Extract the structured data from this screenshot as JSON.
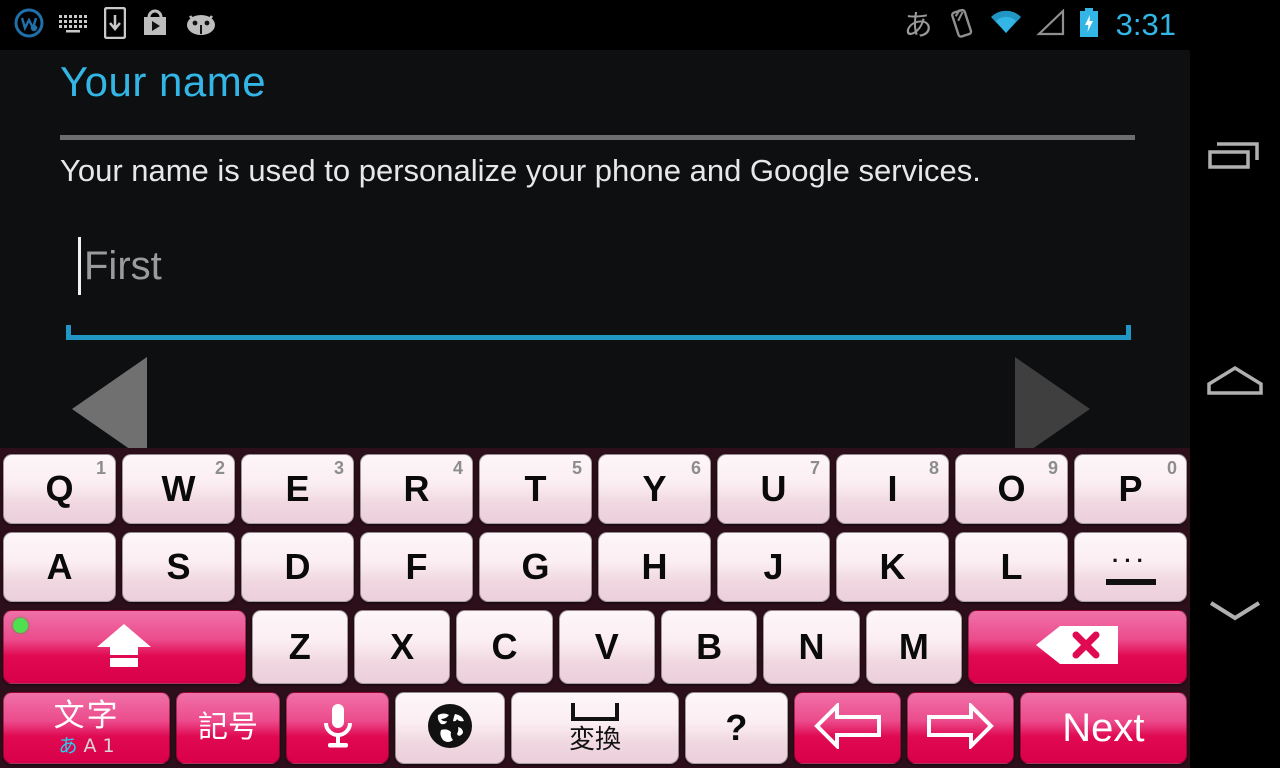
{
  "statusbar": {
    "left_icons": [
      {
        "name": "whatsapp-like-app-icon",
        "label": "w"
      },
      {
        "name": "keyboard-icon",
        "label": "keyboard"
      },
      {
        "name": "download-to-device-icon",
        "label": "download"
      },
      {
        "name": "play-store-icon",
        "label": "play-store"
      },
      {
        "name": "android-mascot-icon",
        "label": "android"
      }
    ],
    "ime_indicator": "あ",
    "right_icons": [
      {
        "name": "vibrate-icon",
        "label": "vibrate"
      },
      {
        "name": "wifi-icon",
        "label": "wifi"
      },
      {
        "name": "signal-icon",
        "label": "signal"
      },
      {
        "name": "battery-charging-icon",
        "label": "battery"
      }
    ],
    "clock": "3:31",
    "clock_color": "#33b5e5"
  },
  "content": {
    "title": "Your name",
    "title_color": "#33b5e5",
    "description": "Your name is used to personalize your phone and Google services.",
    "name_field": {
      "value": "",
      "placeholder": "First",
      "underline_color": "#2196c4"
    },
    "prev_arrow_label": "Previous",
    "next_arrow_label": "Next"
  },
  "navbar": {
    "recent_label": "Recent apps",
    "home_label": "Home",
    "hide_keyboard_label": "Hide keyboard"
  },
  "keyboard": {
    "background_color": "#2c0f1a",
    "key_pink_color": "#e00a52",
    "row1": [
      {
        "label": "Q",
        "sup": "1"
      },
      {
        "label": "W",
        "sup": "2"
      },
      {
        "label": "E",
        "sup": "3"
      },
      {
        "label": "R",
        "sup": "4"
      },
      {
        "label": "T",
        "sup": "5"
      },
      {
        "label": "Y",
        "sup": "6"
      },
      {
        "label": "U",
        "sup": "7"
      },
      {
        "label": "I",
        "sup": "8"
      },
      {
        "label": "O",
        "sup": "9"
      },
      {
        "label": "P",
        "sup": "0"
      }
    ],
    "row2": [
      {
        "label": "A"
      },
      {
        "label": "S"
      },
      {
        "label": "D"
      },
      {
        "label": "F"
      },
      {
        "label": "G"
      },
      {
        "label": "H"
      },
      {
        "label": "J"
      },
      {
        "label": "K"
      },
      {
        "label": "L"
      },
      {
        "label": "…—",
        "name": "ellipsis-dash-key"
      }
    ],
    "row3": {
      "shift_label": "shift",
      "letters": [
        {
          "label": "Z"
        },
        {
          "label": "X"
        },
        {
          "label": "C"
        },
        {
          "label": "V"
        },
        {
          "label": "B"
        },
        {
          "label": "N"
        },
        {
          "label": "M"
        }
      ],
      "backspace_label": "backspace"
    },
    "row4": {
      "mode_main": "文字",
      "mode_sub_a": "あ",
      "mode_sub_b": "A",
      "mode_sub_c": "1",
      "symbol_label": "記号",
      "mic_label": "voice input",
      "globe_label": "language switch",
      "space_label": "変換",
      "question_label": "?",
      "arrow_left_label": "move cursor left",
      "arrow_right_label": "move cursor right",
      "next_label": "Next"
    }
  }
}
